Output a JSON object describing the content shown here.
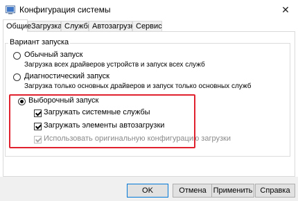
{
  "window": {
    "title": "Конфигурация системы",
    "close_symbol": "✕",
    "icon": "msconfig-icon"
  },
  "tabs": [
    {
      "label": "Общие",
      "active": true
    },
    {
      "label": "Загрузка"
    },
    {
      "label": "Службы"
    },
    {
      "label": "Автозагрузка"
    },
    {
      "label": "Сервис"
    }
  ],
  "startup": {
    "group_label": "Вариант запуска",
    "normal": {
      "label": "Обычный запуск",
      "description": "Загрузка всех драйверов устройств и запуск всех служб",
      "selected": false
    },
    "diagnostic": {
      "label": "Диагностический запуск",
      "description": "Загрузка только основных драйверов и запуск только основных служб",
      "selected": false
    },
    "selective": {
      "label": "Выборочный запуск",
      "selected": true,
      "options": [
        {
          "label": "Загружать системные службы",
          "checked": true,
          "enabled": true
        },
        {
          "label": "Загружать элементы автозагрузки",
          "checked": true,
          "enabled": true
        },
        {
          "label": "Использовать оригинальную конфигурацию загрузки",
          "checked": true,
          "enabled": false
        }
      ]
    }
  },
  "buttons": {
    "ok": "OK",
    "cancel": "Отмена",
    "apply": "Применить",
    "help": "Справка"
  },
  "colors": {
    "highlight": "#e0202c",
    "default_button_border": "#0078d7"
  }
}
